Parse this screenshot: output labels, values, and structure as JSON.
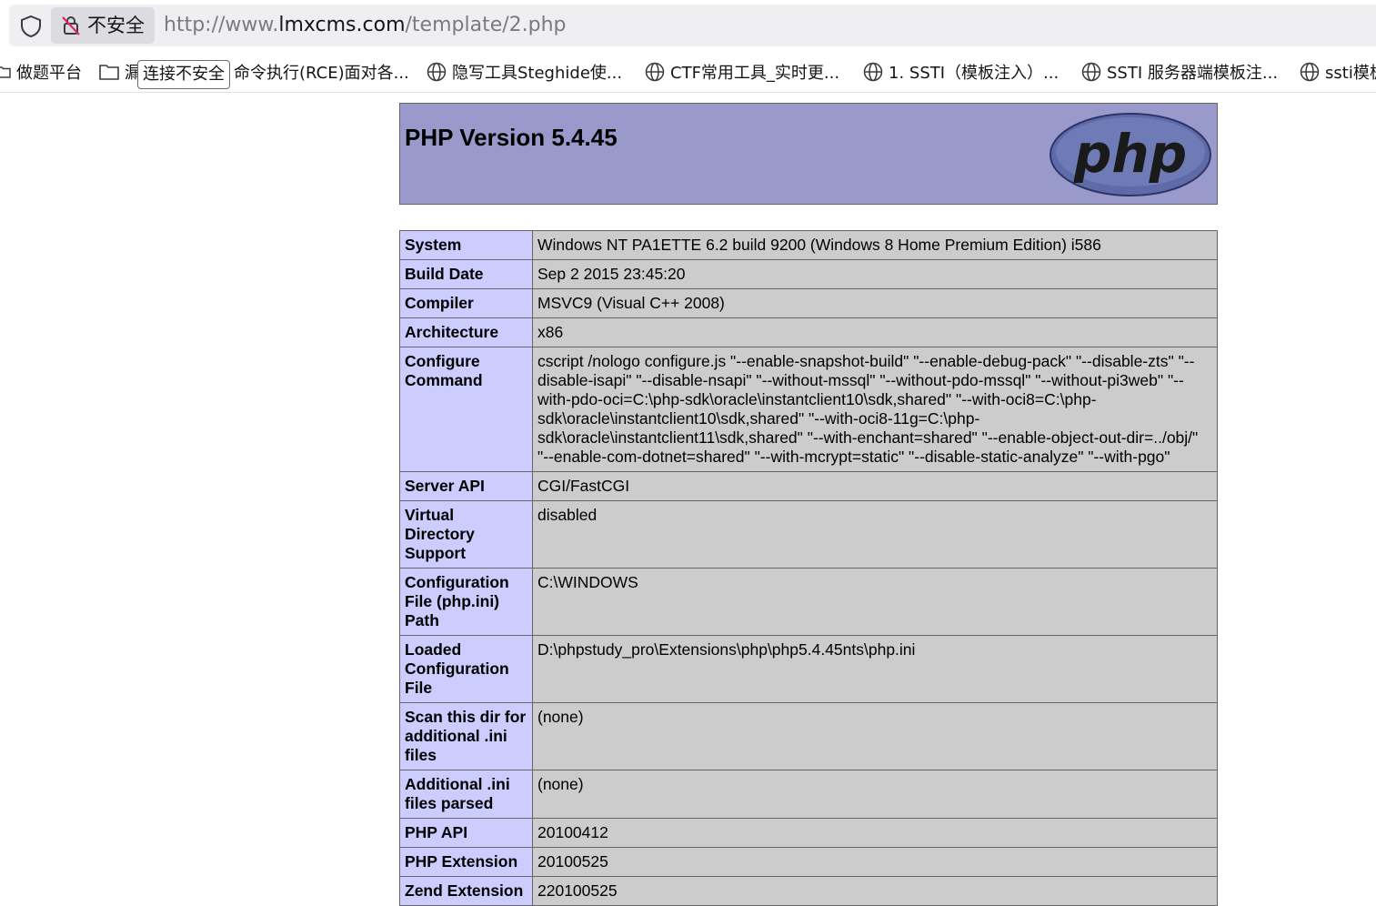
{
  "browser": {
    "security_label": "不安全",
    "url_prefix": "http://www.",
    "url_host": "lmxcms.com",
    "url_path": "/template/2.php",
    "tooltip": "连接不安全",
    "bookmarks": [
      {
        "icon": "folder-icon",
        "label": "做题平台"
      },
      {
        "icon": "folder-icon",
        "label": "漏"
      },
      {
        "icon": "none",
        "label": "命令执行(RCE)面对各..."
      },
      {
        "icon": "globe-icon",
        "label": "隐写工具Steghide使..."
      },
      {
        "icon": "globe-icon",
        "label": "CTF常用工具_实时更..."
      },
      {
        "icon": "globe-icon",
        "label": "1. SSTI（模板注入）..."
      },
      {
        "icon": "globe-icon",
        "label": "SSTI 服务器端模板注..."
      },
      {
        "icon": "globe-icon",
        "label": "ssti模板"
      }
    ]
  },
  "page": {
    "title": "PHP Version 5.4.45",
    "logo_text": "php",
    "colors": {
      "header": "#9999cc",
      "key_cell": "#ccccff",
      "value_cell": "#cccccc"
    },
    "rows": [
      {
        "key": "System",
        "value": "Windows NT PA1ETTE 6.2 build 9200 (Windows 8 Home Premium Edition) i586"
      },
      {
        "key": "Build Date",
        "value": "Sep 2 2015 23:45:20"
      },
      {
        "key": "Compiler",
        "value": "MSVC9 (Visual C++ 2008)"
      },
      {
        "key": "Architecture",
        "value": "x86"
      },
      {
        "key": "Configure Command",
        "value": "cscript /nologo configure.js \"--enable-snapshot-build\" \"--enable-debug-pack\" \"--disable-zts\" \"--disable-isapi\" \"--disable-nsapi\" \"--without-mssql\" \"--without-pdo-mssql\" \"--without-pi3web\" \"--with-pdo-oci=C:\\php-sdk\\oracle\\instantclient10\\sdk,shared\" \"--with-oci8=C:\\php-sdk\\oracle\\instantclient10\\sdk,shared\" \"--with-oci8-11g=C:\\php-sdk\\oracle\\instantclient11\\sdk,shared\" \"--with-enchant=shared\" \"--enable-object-out-dir=../obj/\" \"--enable-com-dotnet=shared\" \"--with-mcrypt=static\" \"--disable-static-analyze\" \"--with-pgo\""
      },
      {
        "key": "Server API",
        "value": "CGI/FastCGI"
      },
      {
        "key": "Virtual Directory Support",
        "value": "disabled"
      },
      {
        "key": "Configuration File (php.ini) Path",
        "value": "C:\\WINDOWS"
      },
      {
        "key": "Loaded Configuration File",
        "value": "D:\\phpstudy_pro\\Extensions\\php\\php5.4.45nts\\php.ini"
      },
      {
        "key": "Scan this dir for additional .ini files",
        "value": "(none)"
      },
      {
        "key": "Additional .ini files parsed",
        "value": "(none)"
      },
      {
        "key": "PHP API",
        "value": "20100412"
      },
      {
        "key": "PHP Extension",
        "value": "20100525"
      },
      {
        "key": "Zend Extension",
        "value": "220100525"
      }
    ]
  }
}
